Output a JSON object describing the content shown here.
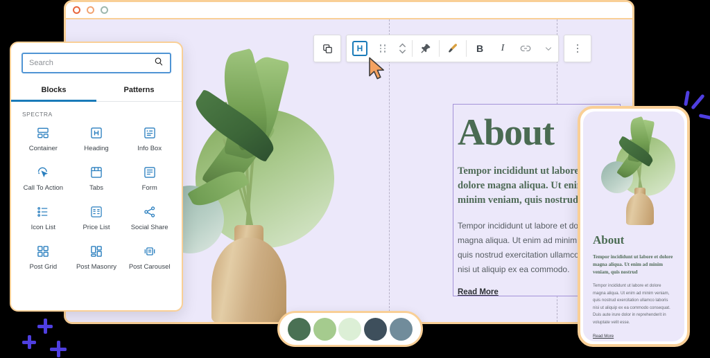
{
  "window": {
    "traffic_lights": [
      "close",
      "minimize",
      "maximize"
    ]
  },
  "inserter": {
    "search": {
      "placeholder": "Search",
      "value": "",
      "icon": "search-icon"
    },
    "tabs": [
      {
        "label": "Blocks",
        "active": true
      },
      {
        "label": "Patterns",
        "active": false
      }
    ],
    "section_label": "SPECTRA",
    "blocks": [
      {
        "label": "Container",
        "icon": "container-icon"
      },
      {
        "label": "Heading",
        "icon": "heading-icon"
      },
      {
        "label": "Info Box",
        "icon": "info-box-icon"
      },
      {
        "label": "Call To Action",
        "icon": "call-to-action-icon"
      },
      {
        "label": "Tabs",
        "icon": "tabs-icon"
      },
      {
        "label": "Form",
        "icon": "form-icon"
      },
      {
        "label": "Icon List",
        "icon": "icon-list-icon"
      },
      {
        "label": "Price List",
        "icon": "price-list-icon"
      },
      {
        "label": "Social Share",
        "icon": "social-share-icon"
      },
      {
        "label": "Post Grid",
        "icon": "post-grid-icon"
      },
      {
        "label": "Post Masonry",
        "icon": "post-masonry-icon"
      },
      {
        "label": "Post Carousel",
        "icon": "post-carousel-icon"
      }
    ]
  },
  "toolbar": {
    "duplicate_label": "",
    "buttons": [
      {
        "name": "block-type-heading",
        "glyph": "H",
        "active": true
      },
      {
        "name": "drag-handle",
        "glyph": "",
        "active": false
      },
      {
        "name": "move-up-down",
        "glyph": "",
        "active": false
      },
      {
        "name": "pin",
        "glyph": "",
        "active": false
      },
      {
        "name": "paintbrush",
        "glyph": "",
        "active": false
      },
      {
        "name": "bold",
        "glyph": "B",
        "active": false
      },
      {
        "name": "italic",
        "glyph": "I",
        "active": false
      },
      {
        "name": "link",
        "glyph": "",
        "active": false
      },
      {
        "name": "more-rich-text",
        "glyph": "",
        "active": false
      },
      {
        "name": "options",
        "glyph": "",
        "active": false
      }
    ],
    "bold_label": "B",
    "italic_label": "I",
    "heading_label": "H"
  },
  "content": {
    "heading": "About",
    "subheading": "Tempor incididunt ut labore et dolore magna aliqua. Ut enim ad minim veniam, quis nostrud",
    "body": "Tempor incididunt ut labore et dolore magna aliqua. Ut enim ad minim veniam, quis nostrud exercitation ullamco laboris nisi ut aliquip ex ea commodo.",
    "link": "Read More"
  },
  "mobile": {
    "heading": "About",
    "subheading": "Tempor incididunt ut labore et dolore magna aliqua. Ut enim ad minim veniam, quis nostrud",
    "body": "Tempor incididunt ut labore et dolore magna aliqua. Ut enim ad minim veniam, quis nostrud exercitation ullamco laboris nisi ut aliquip ex ea commodo consequat. Duis aute irure dolor in reprehenderit in voluptate velit esse.",
    "link": "Read More"
  },
  "palette": {
    "swatches": [
      {
        "name": "dark-green",
        "hex": "#4a7154"
      },
      {
        "name": "light-green",
        "hex": "#a5cb8e"
      },
      {
        "name": "pale-green",
        "hex": "#dcefd6"
      },
      {
        "name": "slate-dark",
        "hex": "#3e4f5c"
      },
      {
        "name": "slate-blue",
        "hex": "#718c9b"
      }
    ]
  },
  "theme": {
    "accent_border": "#f9cf96",
    "canvas_bg": "#ece8fa",
    "heading_green": "#4a6b52",
    "toolbar_blue": "#1a7bb9",
    "spark_blue": "#4f3fe0"
  }
}
